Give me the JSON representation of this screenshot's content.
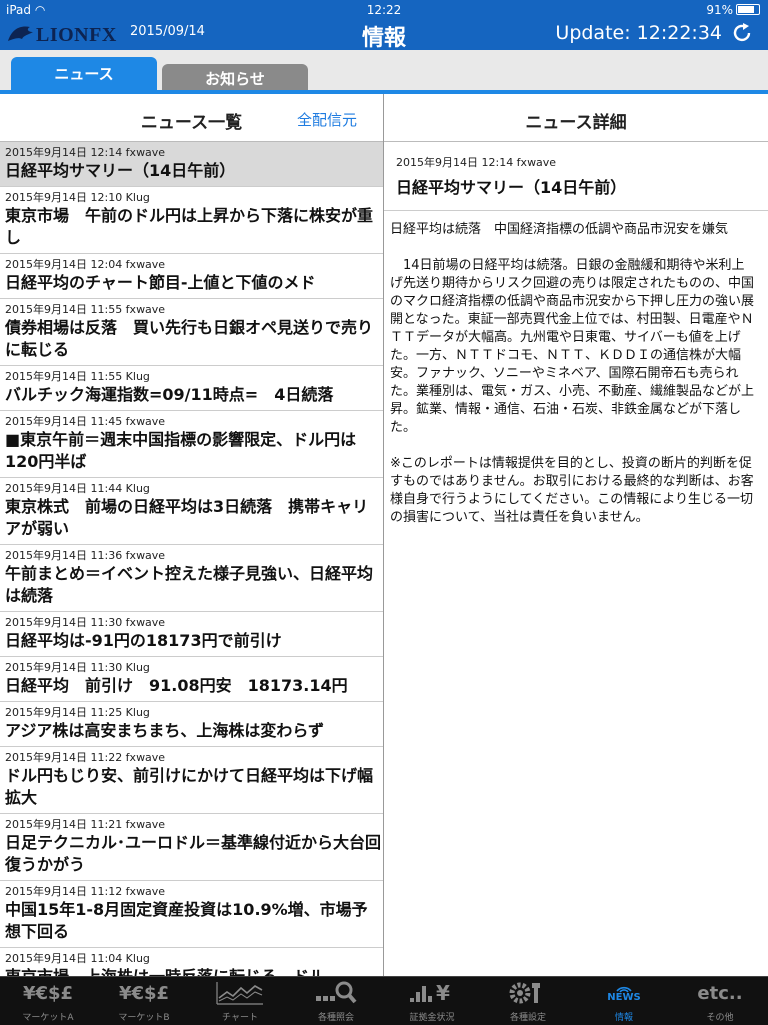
{
  "status": {
    "device": "iPad",
    "time": "12:22",
    "battery": "91%",
    "battery_level": 0.91
  },
  "header": {
    "logo": "LIONFX",
    "date": "2015/09/14",
    "title": "情報",
    "update": "Update: 12:22:34"
  },
  "tabs": [
    {
      "label": "ニュース",
      "active": true
    },
    {
      "label": "お知らせ",
      "active": false
    }
  ],
  "list": {
    "title": "ニュース一覧",
    "filter_label": "全配信元",
    "items": [
      {
        "meta": "2015年9月14日 12:14 fxwave",
        "title": "日経平均サマリー（14日午前）"
      },
      {
        "meta": "2015年9月14日 12:10 Klug",
        "title": "東京市場　午前のドル円は上昇から下落に株安が重し"
      },
      {
        "meta": "2015年9月14日 12:04 fxwave",
        "title": "日経平均のチャート節目-上値と下値のメド"
      },
      {
        "meta": "2015年9月14日 11:55 fxwave",
        "title": "債券相場は反落　買い先行も日銀オペ見送りで売りに転じる"
      },
      {
        "meta": "2015年9月14日 11:55 Klug",
        "title": "バルチック海運指数=09/11時点=　4日続落"
      },
      {
        "meta": "2015年9月14日 11:45 fxwave",
        "title": "■東京午前＝週末中国指標の影響限定、ドル円は120円半ば"
      },
      {
        "meta": "2015年9月14日 11:44 Klug",
        "title": "東京株式　前場の日経平均は3日続落　携帯キャリアが弱い"
      },
      {
        "meta": "2015年9月14日 11:36 fxwave",
        "title": "午前まとめ＝イベント控えた様子見強い、日経平均は続落"
      },
      {
        "meta": "2015年9月14日 11:30 fxwave",
        "title": "日経平均は-91円の18173円で前引け"
      },
      {
        "meta": "2015年9月14日 11:30 Klug",
        "title": "日経平均　前引け　91.08円安　18173.14円"
      },
      {
        "meta": "2015年9月14日 11:25 Klug",
        "title": "アジア株は高安まちまち、上海株は変わらず"
      },
      {
        "meta": "2015年9月14日 11:22 fxwave",
        "title": "ドル円もじり安、前引けにかけて日経平均は下げ幅拡大"
      },
      {
        "meta": "2015年9月14日 11:21 fxwave",
        "title": "日足テクニカル･ユーロドル＝基準線付近から大台回復うかがう"
      },
      {
        "meta": "2015年9月14日 11:12 fxwave",
        "title": "中国15年1-8月固定資産投資は10.9%増、市場予想下回る"
      },
      {
        "meta": "2015年9月14日 11:04 Klug",
        "title": "東京市場　上海株は一時反落に転じる　ドル"
      }
    ]
  },
  "detail": {
    "title": "ニュース詳細",
    "meta": "2015年9月14日 12:14 fxwave",
    "headline": "日経平均サマリー（14日午前）",
    "body": "日経平均は続落　中国経済指標の低調や商品市況安を嫌気\n\n　14日前場の日経平均は続落。日銀の金融緩和期待や米利上げ先送り期待からリスク回避の売りは限定されたものの、中国のマクロ経済指標の低調や商品市況安から下押し圧力の強い展開となった。東証一部売買代金上位では、村田製、日電産やＮＴＴデータが大幅高。九州電や日東電、サイバーも値を上げた。一方、ＮＴＴドコモ、ＮＴＴ、ＫＤＤＩの通信株が大幅安。ファナック、ソニーやミネベア、国際石開帝石も売られた。業種別は、電気・ガス、小売、不動産、繊維製品などが上昇。鉱業、情報・通信、石油・石炭、非鉄金属などが下落した。\n\n※このレポートは情報提供を目的とし、投資の断片的判断を促すものではありません。お取引における最終的な判断は、お客様自身で行うようにしてください。この情報により生じる一切の損害について、当社は責任を負いません。"
  },
  "tabbar": [
    {
      "icon": "¥€$£",
      "label": "マーケットA"
    },
    {
      "icon": "¥€$£",
      "label": "マーケットB"
    },
    {
      "icon": "chart-icon",
      "label": "チャート"
    },
    {
      "icon": "search-icon",
      "label": "各種照会"
    },
    {
      "icon": "deposit-icon",
      "label": "証拠金状況"
    },
    {
      "icon": "settings-icon",
      "label": "各種設定"
    },
    {
      "icon": "NEWS",
      "label": "情報",
      "active": true
    },
    {
      "icon": "etc..",
      "label": "その他"
    }
  ]
}
